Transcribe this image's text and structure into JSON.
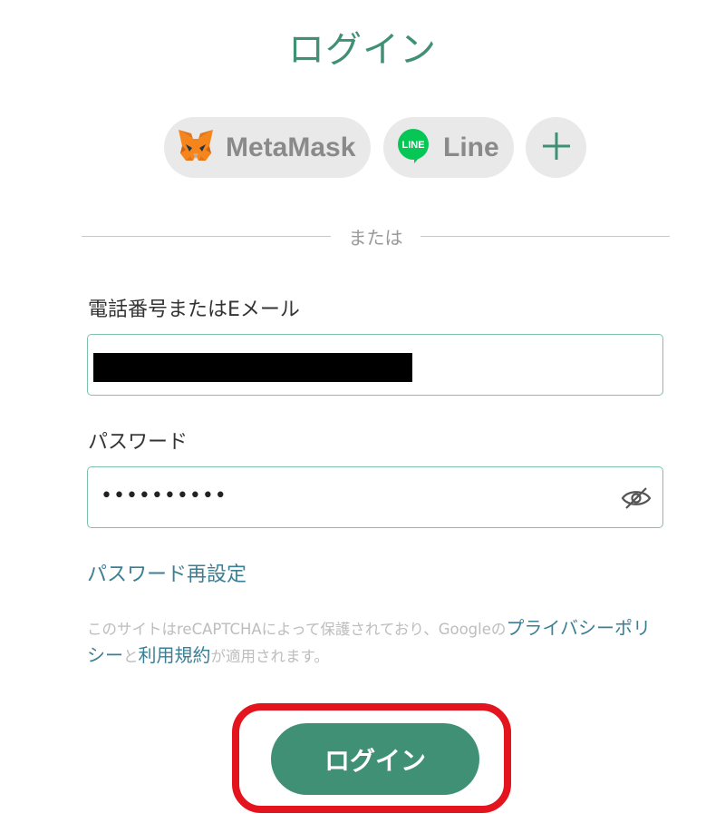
{
  "page": {
    "title": "ログイン"
  },
  "oauth": {
    "metamask_label": "MetaMask",
    "line_label": "Line",
    "line_icon_text": "LINE",
    "more_icon": "plus-icon"
  },
  "divider": {
    "text": "または"
  },
  "form": {
    "phone_email_label": "電話番号またはEメール",
    "phone_email_value_redacted": true,
    "password_label": "パスワード",
    "password_value": "••••••••••",
    "reset_password_link": "パスワード再設定"
  },
  "recaptcha": {
    "text_before": "このサイトはreCAPTCHAによって保護されており、Googleの",
    "privacy_link": "プライバシーポリシー",
    "text_and": "と",
    "terms_link": "利用規約",
    "text_after": "が適用されます。"
  },
  "login_button": {
    "label": "ログイン"
  },
  "colors": {
    "accent": "#3f9075",
    "link": "#3b7f95",
    "pill_bg": "#e9e9e9",
    "input_border": "#7cc3aa",
    "highlight": "#e3141e"
  }
}
